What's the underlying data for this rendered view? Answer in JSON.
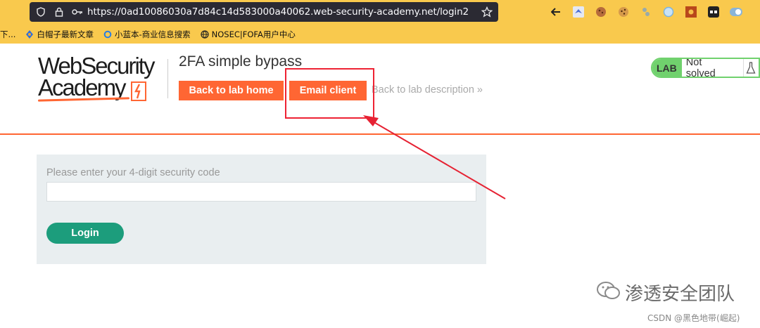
{
  "browser": {
    "url": "https://0ad10086030a7d84c14d583000a40062.web-security-academy.net/login2",
    "bookmarks": [
      {
        "label": "下..."
      },
      {
        "label": "白帽子最新文章"
      },
      {
        "label": "小蓝本-商业信息搜索"
      },
      {
        "label": "NOSEC|FOFA用户中心"
      }
    ]
  },
  "header": {
    "logo_line1": "WebSecurity",
    "logo_line2": "Academy",
    "lab_title": "2FA simple bypass",
    "back_home_label": "Back to lab home",
    "email_client_label": "Email client",
    "back_desc_label": "Back to lab description  »",
    "lab_badge": "LAB",
    "lab_status": "Not solved"
  },
  "form": {
    "label": "Please enter your 4-digit security code",
    "input_value": "",
    "login_label": "Login"
  },
  "watermark": {
    "main": "渗透安全团队",
    "sub": "CSDN @黑色地带(崛起)"
  },
  "colors": {
    "accent": "#ff6633",
    "green": "#1c9d7c",
    "lab_green": "#70d16d",
    "annotation_red": "#e62233"
  }
}
